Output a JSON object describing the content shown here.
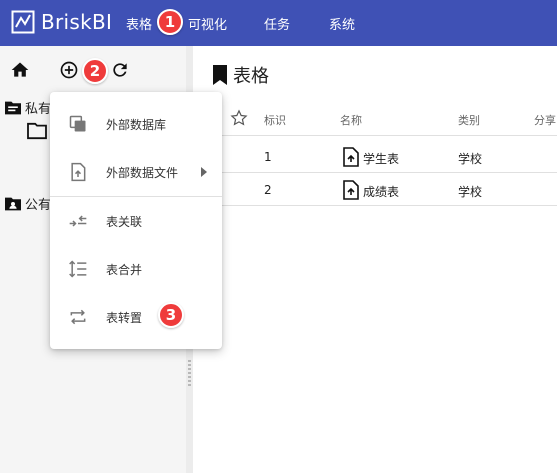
{
  "app": {
    "brand": "BriskBI"
  },
  "nav": {
    "items": [
      "表格",
      "可视化",
      "任务",
      "系统"
    ]
  },
  "badges": [
    "1",
    "2",
    "3"
  ],
  "sidebar": {
    "tree": [
      {
        "label": "私有",
        "icon": "private-folder-icon"
      },
      {
        "label": "",
        "icon": "folder-icon"
      },
      {
        "label": "公有",
        "icon": "public-folder-icon"
      }
    ]
  },
  "main": {
    "title": "表格",
    "columns": [
      "标识",
      "名称",
      "类别",
      "分享"
    ],
    "rows": [
      {
        "id": "1",
        "name": "学生表",
        "category": "学校"
      },
      {
        "id": "2",
        "name": "成绩表",
        "category": "学校"
      }
    ]
  },
  "menu": {
    "items": [
      {
        "label": "外部数据库",
        "icon": "copy-icon"
      },
      {
        "label": "外部数据文件",
        "icon": "file-upload-icon",
        "submenu": true
      },
      {
        "label": "表关联",
        "icon": "join-arrows-icon"
      },
      {
        "label": "表合并",
        "icon": "merge-lines-icon"
      },
      {
        "label": "表转置",
        "icon": "transpose-arrows-icon"
      }
    ]
  },
  "colors": {
    "topbar": "#3f51b5",
    "badge": "#ef3b3b"
  }
}
